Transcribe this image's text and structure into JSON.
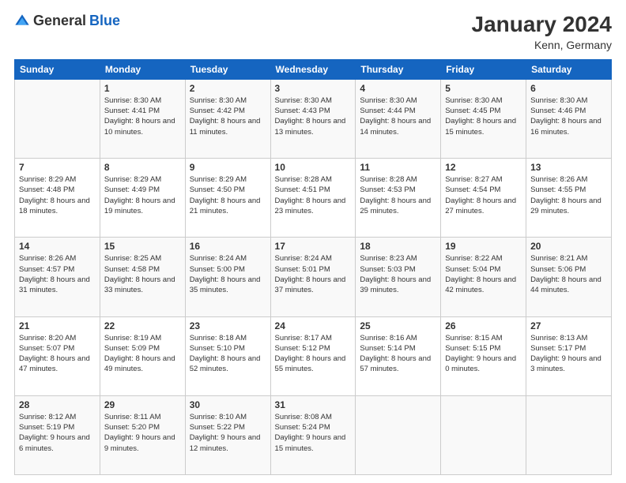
{
  "header": {
    "logo_general": "General",
    "logo_blue": "Blue",
    "month_title": "January 2024",
    "subtitle": "Kenn, Germany"
  },
  "days_of_week": [
    "Sunday",
    "Monday",
    "Tuesday",
    "Wednesday",
    "Thursday",
    "Friday",
    "Saturday"
  ],
  "weeks": [
    [
      {
        "day": "",
        "sunrise": "",
        "sunset": "",
        "daylight": ""
      },
      {
        "day": "1",
        "sunrise": "Sunrise: 8:30 AM",
        "sunset": "Sunset: 4:41 PM",
        "daylight": "Daylight: 8 hours and 10 minutes."
      },
      {
        "day": "2",
        "sunrise": "Sunrise: 8:30 AM",
        "sunset": "Sunset: 4:42 PM",
        "daylight": "Daylight: 8 hours and 11 minutes."
      },
      {
        "day": "3",
        "sunrise": "Sunrise: 8:30 AM",
        "sunset": "Sunset: 4:43 PM",
        "daylight": "Daylight: 8 hours and 13 minutes."
      },
      {
        "day": "4",
        "sunrise": "Sunrise: 8:30 AM",
        "sunset": "Sunset: 4:44 PM",
        "daylight": "Daylight: 8 hours and 14 minutes."
      },
      {
        "day": "5",
        "sunrise": "Sunrise: 8:30 AM",
        "sunset": "Sunset: 4:45 PM",
        "daylight": "Daylight: 8 hours and 15 minutes."
      },
      {
        "day": "6",
        "sunrise": "Sunrise: 8:30 AM",
        "sunset": "Sunset: 4:46 PM",
        "daylight": "Daylight: 8 hours and 16 minutes."
      }
    ],
    [
      {
        "day": "7",
        "sunrise": "Sunrise: 8:29 AM",
        "sunset": "Sunset: 4:48 PM",
        "daylight": "Daylight: 8 hours and 18 minutes."
      },
      {
        "day": "8",
        "sunrise": "Sunrise: 8:29 AM",
        "sunset": "Sunset: 4:49 PM",
        "daylight": "Daylight: 8 hours and 19 minutes."
      },
      {
        "day": "9",
        "sunrise": "Sunrise: 8:29 AM",
        "sunset": "Sunset: 4:50 PM",
        "daylight": "Daylight: 8 hours and 21 minutes."
      },
      {
        "day": "10",
        "sunrise": "Sunrise: 8:28 AM",
        "sunset": "Sunset: 4:51 PM",
        "daylight": "Daylight: 8 hours and 23 minutes."
      },
      {
        "day": "11",
        "sunrise": "Sunrise: 8:28 AM",
        "sunset": "Sunset: 4:53 PM",
        "daylight": "Daylight: 8 hours and 25 minutes."
      },
      {
        "day": "12",
        "sunrise": "Sunrise: 8:27 AM",
        "sunset": "Sunset: 4:54 PM",
        "daylight": "Daylight: 8 hours and 27 minutes."
      },
      {
        "day": "13",
        "sunrise": "Sunrise: 8:26 AM",
        "sunset": "Sunset: 4:55 PM",
        "daylight": "Daylight: 8 hours and 29 minutes."
      }
    ],
    [
      {
        "day": "14",
        "sunrise": "Sunrise: 8:26 AM",
        "sunset": "Sunset: 4:57 PM",
        "daylight": "Daylight: 8 hours and 31 minutes."
      },
      {
        "day": "15",
        "sunrise": "Sunrise: 8:25 AM",
        "sunset": "Sunset: 4:58 PM",
        "daylight": "Daylight: 8 hours and 33 minutes."
      },
      {
        "day": "16",
        "sunrise": "Sunrise: 8:24 AM",
        "sunset": "Sunset: 5:00 PM",
        "daylight": "Daylight: 8 hours and 35 minutes."
      },
      {
        "day": "17",
        "sunrise": "Sunrise: 8:24 AM",
        "sunset": "Sunset: 5:01 PM",
        "daylight": "Daylight: 8 hours and 37 minutes."
      },
      {
        "day": "18",
        "sunrise": "Sunrise: 8:23 AM",
        "sunset": "Sunset: 5:03 PM",
        "daylight": "Daylight: 8 hours and 39 minutes."
      },
      {
        "day": "19",
        "sunrise": "Sunrise: 8:22 AM",
        "sunset": "Sunset: 5:04 PM",
        "daylight": "Daylight: 8 hours and 42 minutes."
      },
      {
        "day": "20",
        "sunrise": "Sunrise: 8:21 AM",
        "sunset": "Sunset: 5:06 PM",
        "daylight": "Daylight: 8 hours and 44 minutes."
      }
    ],
    [
      {
        "day": "21",
        "sunrise": "Sunrise: 8:20 AM",
        "sunset": "Sunset: 5:07 PM",
        "daylight": "Daylight: 8 hours and 47 minutes."
      },
      {
        "day": "22",
        "sunrise": "Sunrise: 8:19 AM",
        "sunset": "Sunset: 5:09 PM",
        "daylight": "Daylight: 8 hours and 49 minutes."
      },
      {
        "day": "23",
        "sunrise": "Sunrise: 8:18 AM",
        "sunset": "Sunset: 5:10 PM",
        "daylight": "Daylight: 8 hours and 52 minutes."
      },
      {
        "day": "24",
        "sunrise": "Sunrise: 8:17 AM",
        "sunset": "Sunset: 5:12 PM",
        "daylight": "Daylight: 8 hours and 55 minutes."
      },
      {
        "day": "25",
        "sunrise": "Sunrise: 8:16 AM",
        "sunset": "Sunset: 5:14 PM",
        "daylight": "Daylight: 8 hours and 57 minutes."
      },
      {
        "day": "26",
        "sunrise": "Sunrise: 8:15 AM",
        "sunset": "Sunset: 5:15 PM",
        "daylight": "Daylight: 9 hours and 0 minutes."
      },
      {
        "day": "27",
        "sunrise": "Sunrise: 8:13 AM",
        "sunset": "Sunset: 5:17 PM",
        "daylight": "Daylight: 9 hours and 3 minutes."
      }
    ],
    [
      {
        "day": "28",
        "sunrise": "Sunrise: 8:12 AM",
        "sunset": "Sunset: 5:19 PM",
        "daylight": "Daylight: 9 hours and 6 minutes."
      },
      {
        "day": "29",
        "sunrise": "Sunrise: 8:11 AM",
        "sunset": "Sunset: 5:20 PM",
        "daylight": "Daylight: 9 hours and 9 minutes."
      },
      {
        "day": "30",
        "sunrise": "Sunrise: 8:10 AM",
        "sunset": "Sunset: 5:22 PM",
        "daylight": "Daylight: 9 hours and 12 minutes."
      },
      {
        "day": "31",
        "sunrise": "Sunrise: 8:08 AM",
        "sunset": "Sunset: 5:24 PM",
        "daylight": "Daylight: 9 hours and 15 minutes."
      },
      {
        "day": "",
        "sunrise": "",
        "sunset": "",
        "daylight": ""
      },
      {
        "day": "",
        "sunrise": "",
        "sunset": "",
        "daylight": ""
      },
      {
        "day": "",
        "sunrise": "",
        "sunset": "",
        "daylight": ""
      }
    ]
  ]
}
